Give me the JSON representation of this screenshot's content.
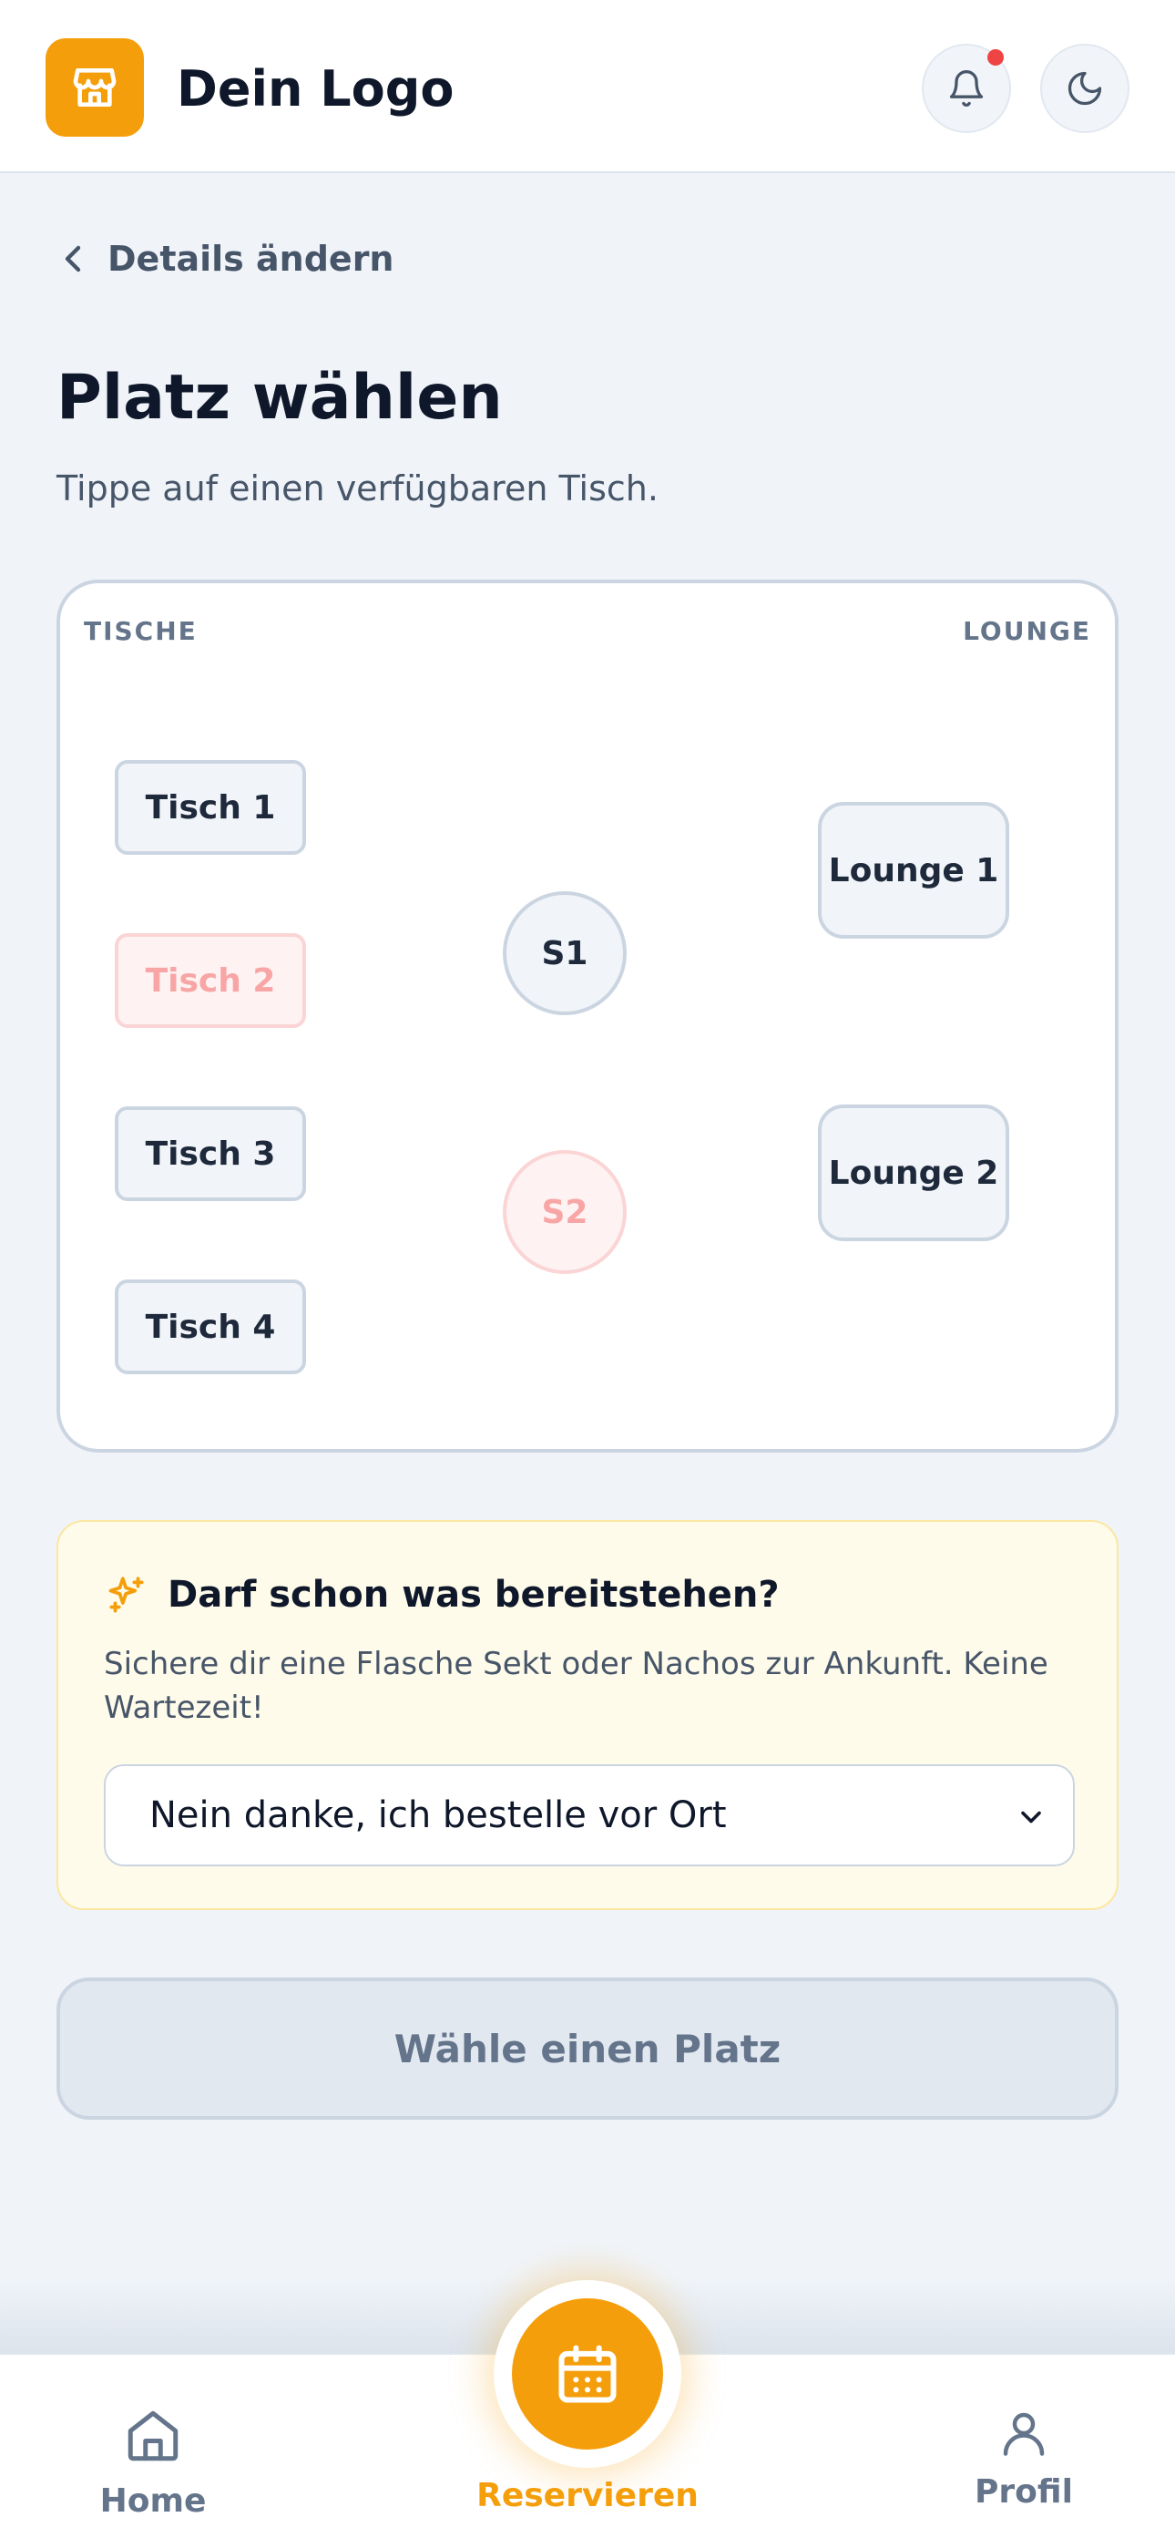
{
  "header": {
    "brand": "Dein Logo",
    "icons": {
      "logo": "store-icon",
      "notifications": "bell-icon",
      "theme": "moon-icon"
    },
    "notification_dot_color": "#ef4444",
    "accent_color": "#f59e0b"
  },
  "nav_back": {
    "label": "Details ändern",
    "icon": "chevron-left-icon"
  },
  "page": {
    "title": "Platz wählen",
    "subtitle": "Tippe auf einen verfügbaren Tisch."
  },
  "floor_plan": {
    "zones": {
      "left": "TISCHE",
      "right": "LOUNGE"
    },
    "tables": [
      {
        "label": "Tisch 1",
        "status": "available"
      },
      {
        "label": "Tisch 2",
        "status": "unavailable"
      },
      {
        "label": "Tisch 3",
        "status": "available"
      },
      {
        "label": "Tisch 4",
        "status": "available"
      },
      {
        "label": "S1",
        "status": "available"
      },
      {
        "label": "S2",
        "status": "unavailable"
      },
      {
        "label": "Lounge 1",
        "status": "available"
      },
      {
        "label": "Lounge 2",
        "status": "available"
      }
    ]
  },
  "upsell": {
    "title": "Darf schon was bereitstehen?",
    "text": "Sichere dir eine Flasche Sekt oder Nachos zur Ankunft. Keine Wartezeit!",
    "icon": "sparkles-icon",
    "select_value": "Nein danke, ich bestelle vor Ort"
  },
  "submit": {
    "label": "Wähle einen Platz"
  },
  "bottom_nav": {
    "items": [
      {
        "label": "Home",
        "icon": "home-icon"
      },
      {
        "label": "Reservieren",
        "icon": "calendar-icon",
        "active": true
      },
      {
        "label": "Profil",
        "icon": "user-icon"
      }
    ]
  }
}
